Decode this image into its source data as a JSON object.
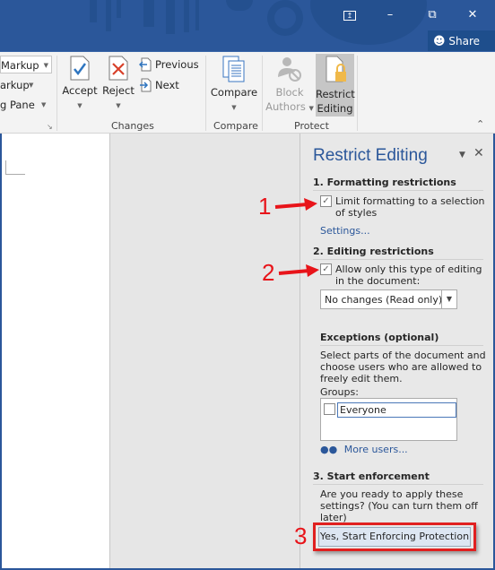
{
  "window": {
    "controls": {
      "ribbon_display_icon": "ribbon-display-options-icon",
      "minimize": "–",
      "restore": "⧉",
      "close": "✕"
    },
    "share_label": "Share"
  },
  "ribbon": {
    "tracking": {
      "markup_select": "Markup",
      "show_markup": "arkup",
      "reviewing_pane": "g Pane"
    },
    "changes": {
      "accept": "Accept",
      "reject": "Reject",
      "previous": "Previous",
      "next": "Next",
      "group_label": "Changes"
    },
    "compare": {
      "compare": "Compare",
      "group_label": "Compare"
    },
    "protect": {
      "block_line1": "Block",
      "block_line2": "Authors",
      "restrict_line1": "Restrict",
      "restrict_line2": "Editing",
      "group_label": "Protect"
    }
  },
  "pane": {
    "title": "Restrict Editing",
    "section1": {
      "heading": "1. Formatting restrictions",
      "checkbox_label_line1": "Limit formatting to a selection",
      "checkbox_label_line2": "of styles",
      "checked": true,
      "settings_link": "Settings..."
    },
    "section2": {
      "heading": "2. Editing restrictions",
      "checkbox_label_line1": "Allow only this type of editing",
      "checkbox_label_line2": "in the document:",
      "checked": true,
      "select_value": "No changes (Read only)",
      "exceptions_heading": "Exceptions (optional)",
      "exceptions_desc_line1": "Select parts of the document and",
      "exceptions_desc_line2": "choose users who are allowed to",
      "exceptions_desc_line3": "freely edit them.",
      "groups_label": "Groups:",
      "groups": [
        {
          "name": "Everyone",
          "checked": false
        }
      ],
      "more_users": "More users..."
    },
    "section3": {
      "heading": "3. Start enforcement",
      "desc_line1": "Are you ready to apply these",
      "desc_line2": "settings? (You can turn them off",
      "desc_line3": "later)",
      "button": "Yes, Start Enforcing Protection"
    }
  },
  "annotations": {
    "callout1": "1",
    "callout2": "2",
    "callout3": "3",
    "color": "#e8141a"
  }
}
